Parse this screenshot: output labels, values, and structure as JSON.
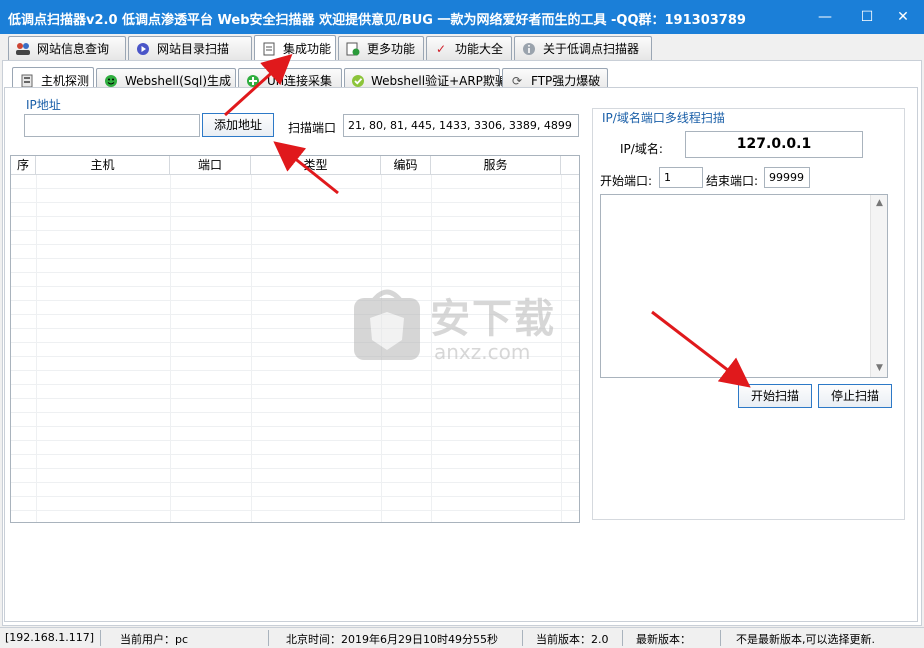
{
  "window": {
    "title": "低调点扫描器v2.0 低调点渗透平台 Web安全扫描器 欢迎提供意见/BUG  一款为网络爱好者而生的工具  -QQ群：191303789",
    "controls": [
      "—",
      "☐",
      "✕"
    ]
  },
  "main_tabs": [
    {
      "label": "网站信息查询",
      "icon": "users-icon"
    },
    {
      "label": "网站目录扫描",
      "icon": "play-circle-icon"
    },
    {
      "label": "集成功能",
      "icon": "document-icon",
      "active": true
    },
    {
      "label": "更多功能",
      "icon": "document-add-icon"
    },
    {
      "label": "功能大全",
      "icon": "checkmark-icon"
    },
    {
      "label": "关于低调点扫描器",
      "icon": "info-icon"
    }
  ],
  "sub_tabs": [
    {
      "label": "主机探测",
      "icon": "host-icon",
      "active": true
    },
    {
      "label": "Webshell(Sql)生成",
      "icon": "smiley-icon"
    },
    {
      "label": "Url连接采集",
      "icon": "plus-circle-icon"
    },
    {
      "label": "Webshell验证+ARP欺骗",
      "icon": "check-circle-icon"
    },
    {
      "label": "FTP强力爆破",
      "icon": "refresh-icon"
    }
  ],
  "host": {
    "ip_group_label": "IP地址",
    "ip_input_value": "",
    "add_button": "添加地址",
    "port_label": "扫描端口",
    "port_value": "21, 80, 81, 445, 1433, 3306, 3389, 4899",
    "columns": [
      "序",
      "主机",
      "端口",
      "类型",
      "编码",
      "服务"
    ]
  },
  "port_scan": {
    "group_label": "IP/域名端口多线程扫描",
    "ip_label": "IP/域名:",
    "ip_value": "127.0.0.1",
    "start_label": "开始端口:",
    "start_value": "1",
    "end_label": "结束端口:",
    "end_value": "99999",
    "start_button": "开始扫描",
    "stop_button": "停止扫描"
  },
  "watermark": {
    "text": "安下载",
    "sub": "anxz.com"
  },
  "status": {
    "ip": "[192.168.1.117]",
    "user": "当前用户：pc",
    "time": "北京时间：2019年6月29日10时49分55秒",
    "version": "当前版本：2.0",
    "latest": "最新版本：",
    "message": "不是最新版本,可以选择更新."
  },
  "colors": {
    "titlebar": "#1b7fd8",
    "accent": "#1a5fa8",
    "arrow": "#e0191c"
  }
}
